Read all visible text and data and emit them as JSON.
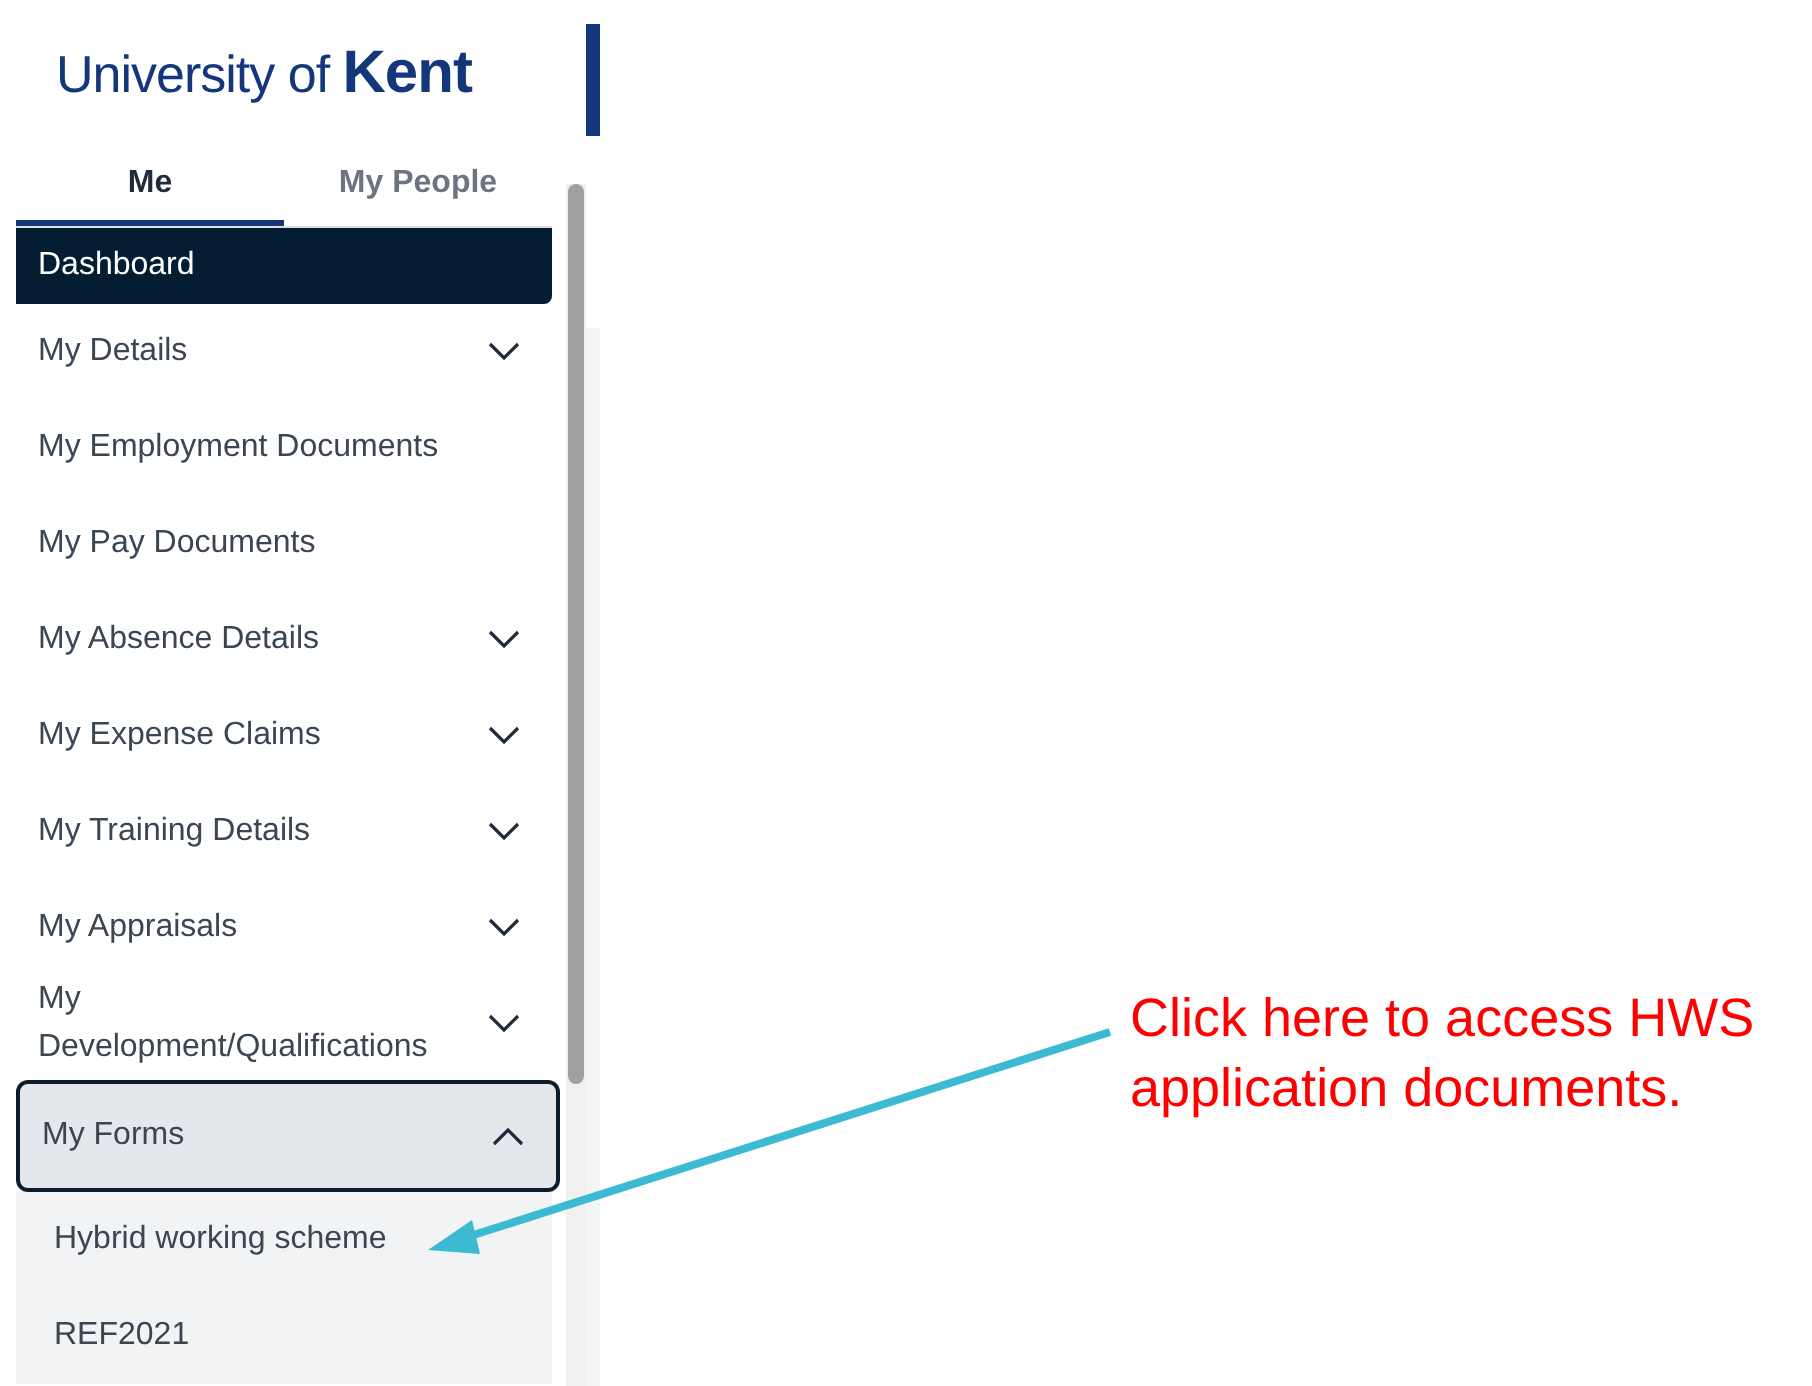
{
  "logo": {
    "text": "University of ",
    "brand": "Kent"
  },
  "tabs": [
    {
      "label": "Me",
      "selected": true
    },
    {
      "label": "My People",
      "selected": false
    }
  ],
  "menu": [
    {
      "label": "Dashboard",
      "kind": "link",
      "selected": true,
      "focused": false
    },
    {
      "label": "My Details",
      "kind": "group",
      "selected": false,
      "focused": false,
      "expanded": false
    },
    {
      "label": "My Employment Documents",
      "kind": "link",
      "selected": false,
      "focused": false
    },
    {
      "label": "My Pay Documents",
      "kind": "link",
      "selected": false,
      "focused": false
    },
    {
      "label": "My Absence Details",
      "kind": "group",
      "selected": false,
      "focused": false,
      "expanded": false
    },
    {
      "label": "My Expense Claims",
      "kind": "group",
      "selected": false,
      "focused": false,
      "expanded": false
    },
    {
      "label": "My Training Details",
      "kind": "group",
      "selected": false,
      "focused": false,
      "expanded": false
    },
    {
      "label": "My Appraisals",
      "kind": "group",
      "selected": false,
      "focused": false,
      "expanded": false
    },
    {
      "label": "My Development/Qualifications",
      "kind": "group",
      "selected": false,
      "focused": false,
      "expanded": false
    },
    {
      "label": "My Forms",
      "kind": "group",
      "selected": false,
      "focused": true,
      "expanded": true,
      "children": [
        {
          "label": "Hybrid working scheme",
          "selected": false
        },
        {
          "label": "REF2021",
          "selected": false
        }
      ]
    }
  ],
  "callout": {
    "text": "Click here to access HWS application documents."
  }
}
